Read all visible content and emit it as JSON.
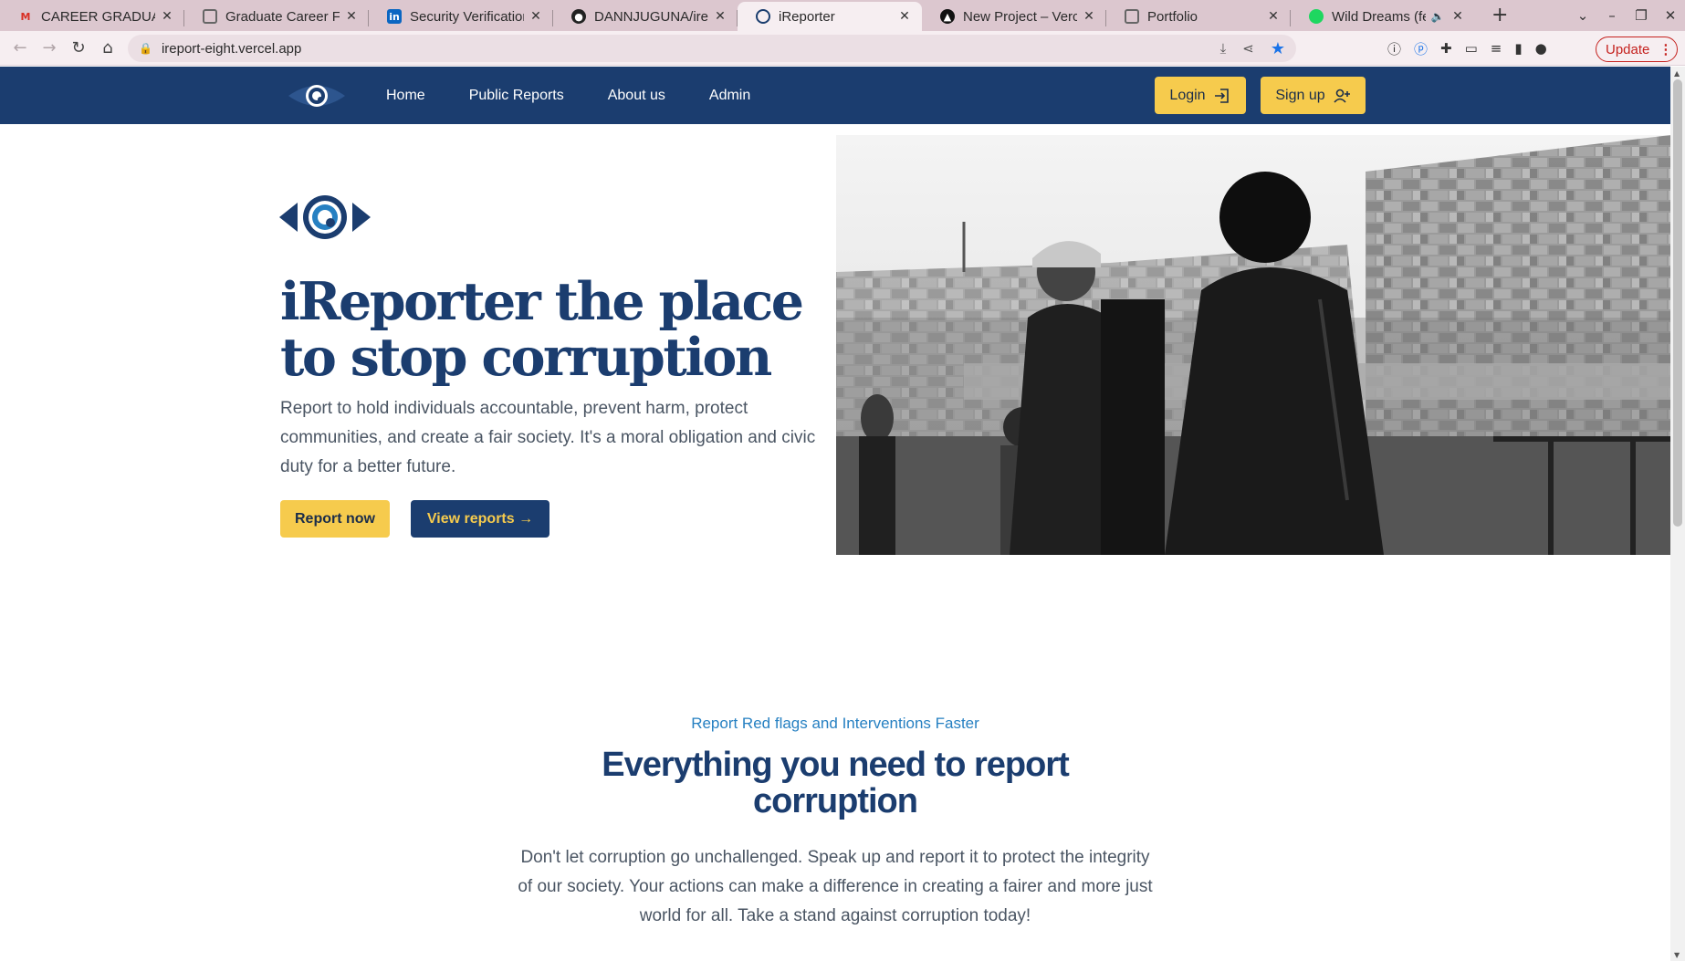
{
  "browser": {
    "tabs": [
      {
        "title": "CAREER GRADUATE",
        "icon": "gmail-icon"
      },
      {
        "title": "Graduate Career For",
        "icon": "globe-icon"
      },
      {
        "title": "Security Verification",
        "icon": "linkedin-icon"
      },
      {
        "title": "DANNJUGUNA/irep",
        "icon": "github-icon"
      },
      {
        "title": "iReporter",
        "icon": "ireporter-icon",
        "active": true
      },
      {
        "title": "New Project – Vercel",
        "icon": "vercel-icon"
      },
      {
        "title": "Portfolio",
        "icon": "globe-icon"
      },
      {
        "title": "Wild Dreams (fea",
        "icon": "spotify-icon",
        "audio": true
      }
    ],
    "url": "ireport-eight.vercel.app",
    "update_label": "Update"
  },
  "nav": {
    "links": [
      "Home",
      "Public Reports",
      "About us",
      "Admin"
    ],
    "login_label": "Login",
    "signup_label": "Sign up"
  },
  "hero": {
    "title": "iReporter the place to stop corruption",
    "description": "Report to hold individuals accountable, prevent harm, protect communities, and create a fair society. It's a moral obligation and civic duty for a better future.",
    "report_button": "Report now",
    "view_button": "View reports →"
  },
  "features": {
    "eyebrow": "Report Red flags and Interventions Faster",
    "title": "Everything you need to report corruption",
    "description": "Don't let corruption go unchallenged. Speak up and report it to protect the integrity of our society. Your actions can make a difference in creating a fairer and more just world for all. Take a stand against corruption today!"
  },
  "colors": {
    "navy": "#1b3d6f",
    "accent_yellow": "#f6cb4d",
    "eyebrow_blue": "#2680c2"
  }
}
